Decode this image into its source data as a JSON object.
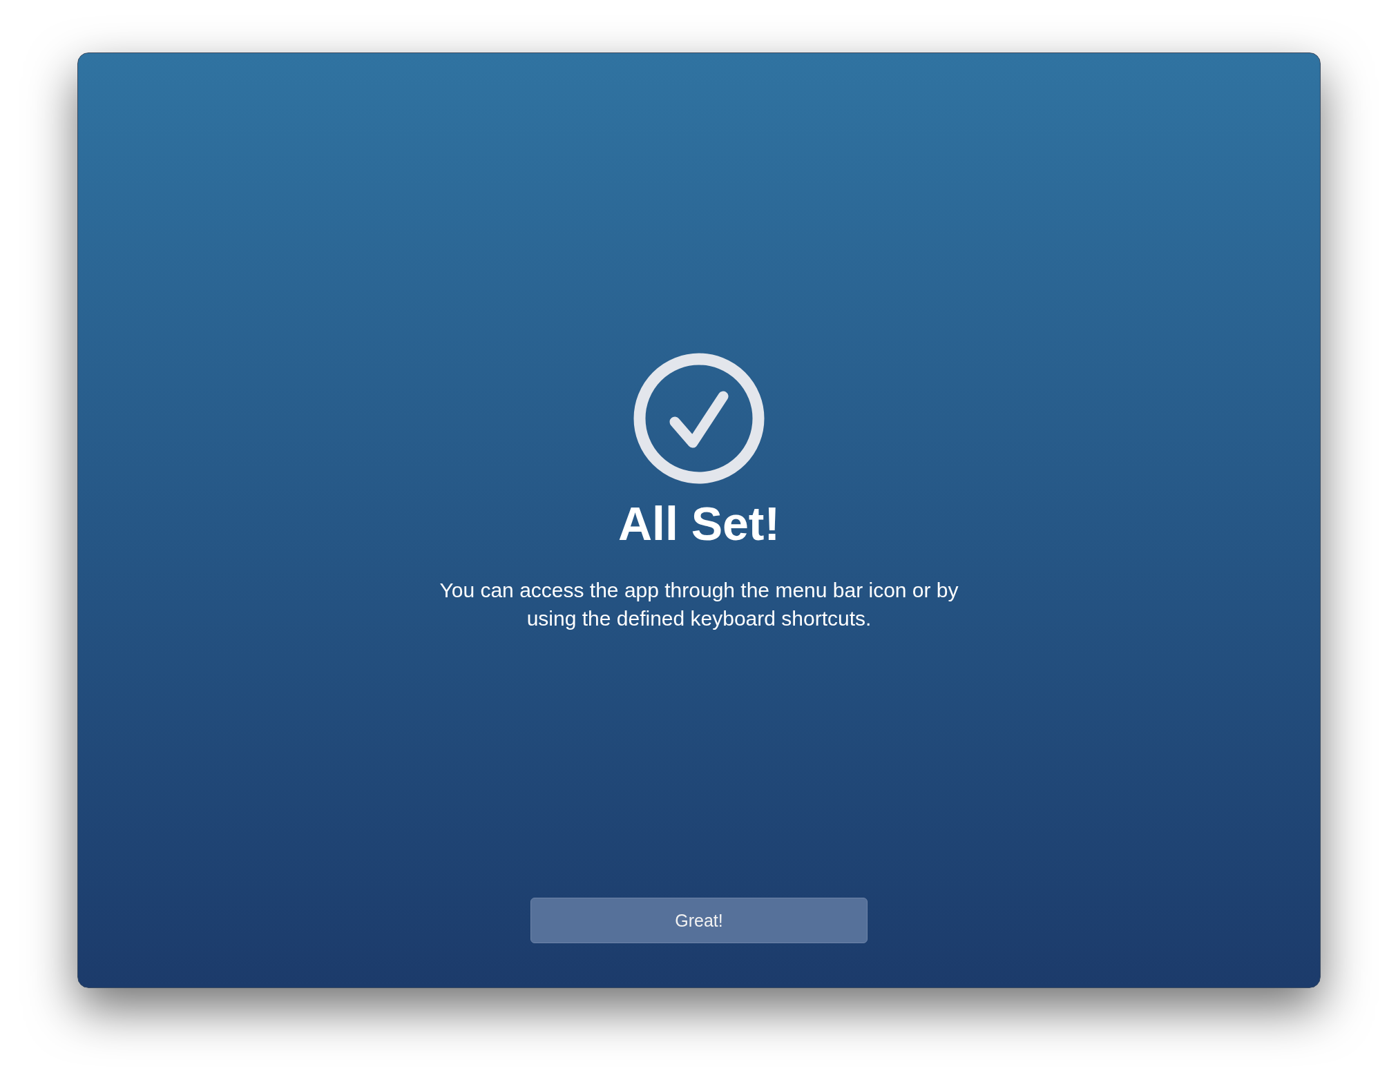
{
  "dialog": {
    "title": "All Set!",
    "message": "You can access the app through the menu bar icon or by using the defined keyboard shortcuts.",
    "button": "Great!"
  }
}
